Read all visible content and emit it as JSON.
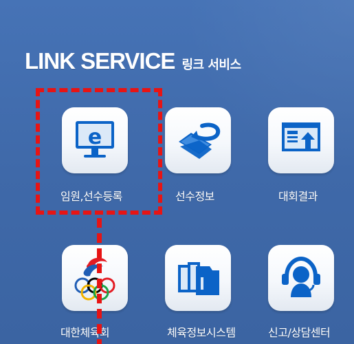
{
  "header": {
    "title_main": "LINK SERVICE",
    "title_sub": "링크 서비스"
  },
  "services": [
    {
      "label": "임원,선수등록",
      "icon": "e-learning-monitor-icon"
    },
    {
      "label": "선수정보",
      "icon": "refresh-folder-icon"
    },
    {
      "label": "대회결과",
      "icon": "upload-window-icon"
    },
    {
      "label": "대한체육회",
      "icon": "olympic-rings-icon"
    },
    {
      "label": "체육정보시스템",
      "icon": "folders-icon"
    },
    {
      "label": "신고/상담센터",
      "icon": "headset-icon"
    }
  ],
  "colors": {
    "background": "#3f6aaa",
    "icon_blue": "#0b63c7",
    "highlight_red": "#e71414"
  }
}
